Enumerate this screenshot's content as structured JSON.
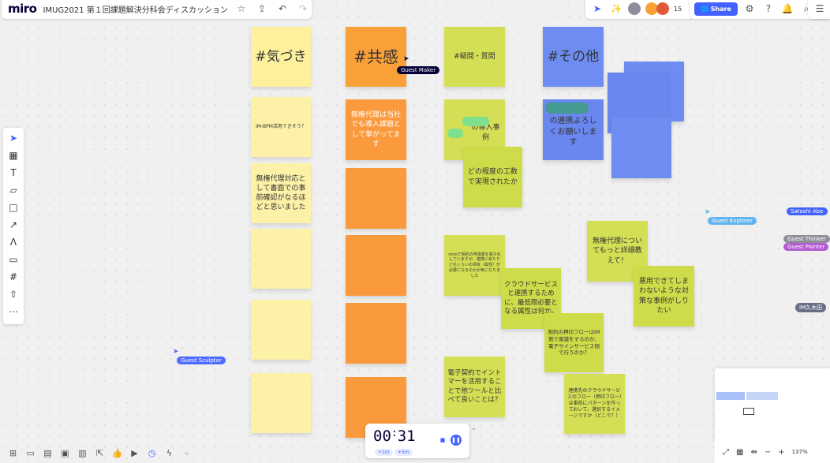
{
  "app": {
    "logo": "miro",
    "board_title": "IMUG2021 第１回課題解決分科会ディスカッション"
  },
  "topbar": {
    "star_icon": "☆",
    "upload_icon": "⇪",
    "undo_icon": "↶",
    "redo_icon": "↷",
    "share_label": "Share",
    "collab_count": "15",
    "accent": "#4262ff"
  },
  "columns": {
    "kizuki": {
      "header": "#気づき",
      "notes": [
        "IM-BPM活用できそう？",
        "無権代理対応として書面での事前確認がなるほどと思いました",
        "",
        "",
        ""
      ]
    },
    "kyokan": {
      "header": "#共感",
      "notes": [
        "無権代理は当社でも導入課題として挙がってます",
        "",
        "",
        "",
        ""
      ]
    },
    "gimon": {
      "header": "#疑問・質問",
      "note1": "の導入事例",
      "note2": "どの程度の工数で実現されたか",
      "note3": "miroで契約の申請書を電子化していますが、連携にあたりどれくらいの項目（属性）が必要になるのかが気になりました",
      "note4": "クラウドサービスと連携するために、最低限必要となる属性は何か。",
      "note5": "電子契約でイントマーを活用することで他ツールと比べて良いことは？",
      "note6": "契約の押印フローはIM側で稟議をするのか、電子サインサービス側で行うのか？",
      "note7": "連携先のクラウドサービスのフロー（押印フロー）は事前にパターンを作っておいて、選択するイメージですか（どこで？）"
    },
    "sonota": {
      "header": "#その他",
      "note1": "の連携よろしくお願いします",
      "note2": "無権代理についてもっと詳細教えて！",
      "note3": "悪用できてしまわないような対策な事例がしりたい"
    }
  },
  "cursors": [
    {
      "label": "Guest Maker",
      "color": "#050038"
    },
    {
      "label": "Guest Explorer",
      "color": "#5fb4f0"
    },
    {
      "label": "Satoshi Abe",
      "color": "#4262ff"
    },
    {
      "label": "Guest Thinker",
      "color": "#8f8f9c"
    },
    {
      "label": "Guest Painter",
      "color": "#b35ad2"
    },
    {
      "label": "IM久木田",
      "color": "#6b6f86"
    },
    {
      "label": "Guest Sculptor",
      "color": "#4f6bff"
    }
  ],
  "timer": {
    "minutes": "00",
    "seconds": "31",
    "add1": "+1m",
    "add5": "+5m"
  },
  "zoom": {
    "level": "137%"
  }
}
